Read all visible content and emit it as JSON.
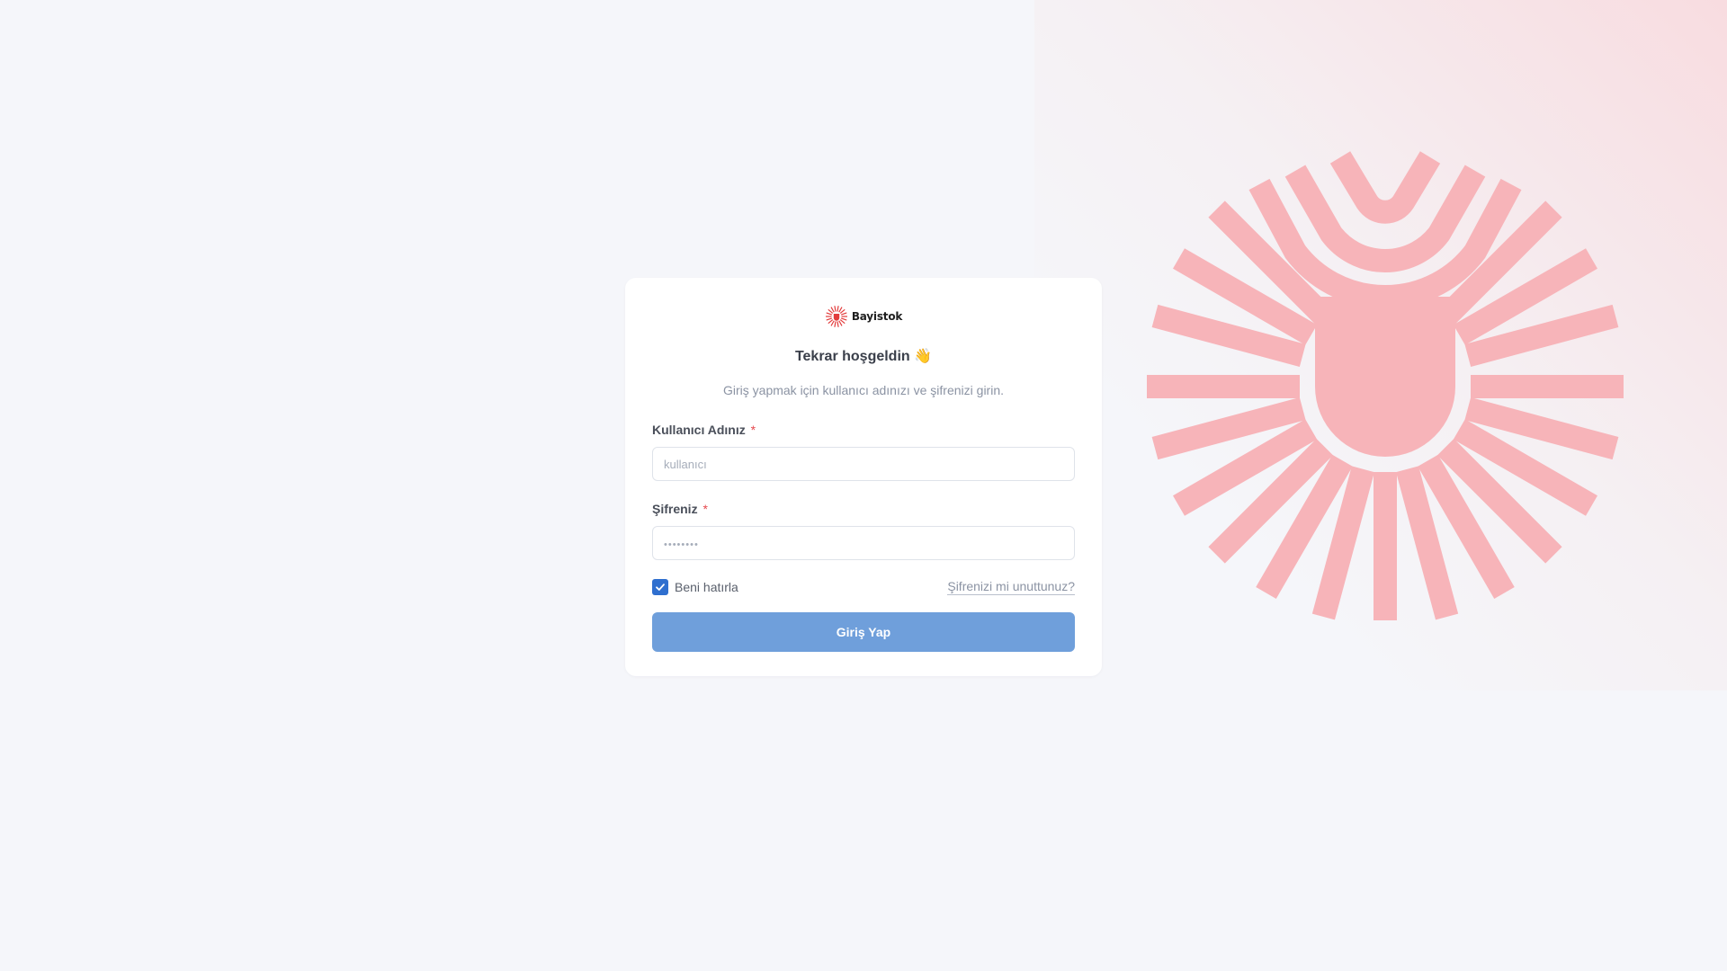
{
  "brand": {
    "name": "Bayistok",
    "logo_icon": "sunburst-logo-icon",
    "accent_color": "#e23b3b"
  },
  "login": {
    "title": "Tekrar hoşgeldin 👋",
    "subtitle": "Giriş yapmak için kullanıcı adınızı ve şifrenizi girin.",
    "username": {
      "label": "Kullanıcı Adınız",
      "required_mark": "*",
      "value": "",
      "placeholder": "kullanıcı"
    },
    "password": {
      "label": "Şifreniz",
      "required_mark": "*",
      "value": "",
      "placeholder": "••••••••"
    },
    "remember_me": {
      "label": "Beni hatırla",
      "checked": true
    },
    "forgot_password_label": "Şifrenizi mi unuttunuz?",
    "submit_label": "Giriş Yap"
  },
  "background": {
    "decor_icon": "sunburst-logo-icon",
    "decor_color": "#f7b4b9",
    "button_color": "#6f9fdb",
    "checkbox_color": "#2f6fcf"
  }
}
